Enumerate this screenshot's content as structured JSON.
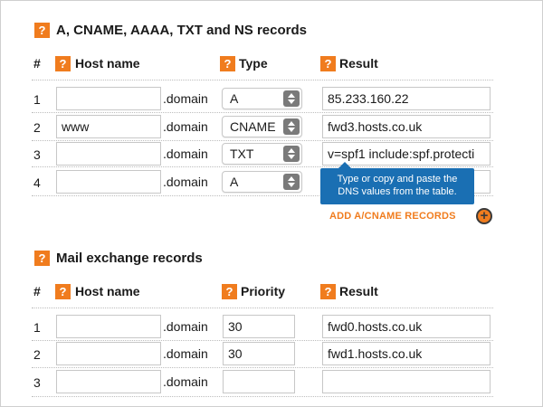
{
  "icons": {
    "help": "?"
  },
  "section1": {
    "title": "A, CNAME, AAAA, TXT and NS records",
    "headers": {
      "num": "#",
      "host": "Host name",
      "type": "Type",
      "result": "Result"
    },
    "domain_suffix": ".domain",
    "rows": [
      {
        "num": "1",
        "host": "",
        "type": "A",
        "result": "85.233.160.22"
      },
      {
        "num": "2",
        "host": "www",
        "type": "CNAME",
        "result": "fwd3.hosts.co.uk"
      },
      {
        "num": "3",
        "host": "",
        "type": "TXT",
        "result": "v=spf1 include:spf.protecti"
      },
      {
        "num": "4",
        "host": "",
        "type": "A",
        "result": ""
      }
    ],
    "tooltip": "Type or copy and paste the DNS values from the table.",
    "add_link": "ADD A/CNAME RECORDS",
    "add_icon": "+"
  },
  "section2": {
    "title": "Mail exchange records",
    "headers": {
      "num": "#",
      "host": "Host name",
      "priority": "Priority",
      "result": "Result"
    },
    "domain_suffix": ".domain",
    "rows": [
      {
        "num": "1",
        "host": "",
        "priority": "30",
        "result": "fwd0.hosts.co.uk"
      },
      {
        "num": "2",
        "host": "",
        "priority": "30",
        "result": "fwd1.hosts.co.uk"
      },
      {
        "num": "3",
        "host": "",
        "priority": "",
        "result": ""
      }
    ]
  },
  "colors": {
    "accent": "#f07c1e",
    "tooltip": "#1a6fb3"
  }
}
